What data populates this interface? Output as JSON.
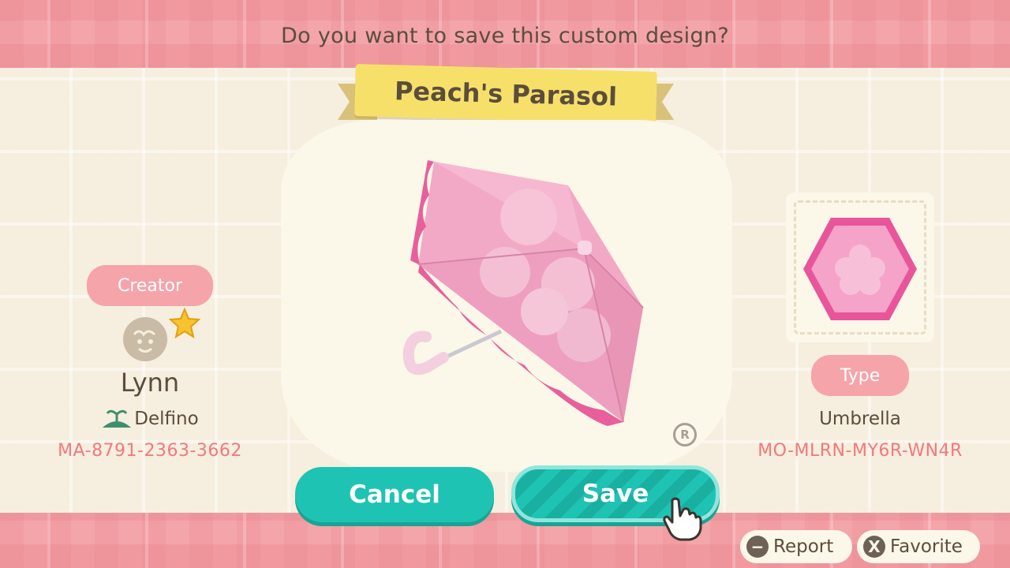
{
  "dialog": {
    "prompt": "Do you want to save this custom design?",
    "design_title": "Peach's Parasol"
  },
  "creator": {
    "section_label": "Creator",
    "name": "Lynn",
    "island": "Delfino",
    "creator_code": "MA-8791-2363-3662"
  },
  "design": {
    "type_label": "Type",
    "type": "Umbrella",
    "design_code": "MO-MLRN-MY6R-WN4R",
    "badge": "R"
  },
  "buttons": {
    "cancel_label": "Cancel",
    "save_label": "Save"
  },
  "footer": {
    "report_glyph": "−",
    "report_label": "Report",
    "favorite_glyph": "X",
    "favorite_label": "Favorite"
  },
  "colors": {
    "accent_teal": "#1ec3b3",
    "pink_band": "#f3a5aa",
    "banner_yellow": "#f7e06a",
    "code_pink": "#f07a7e",
    "text_brown": "#5b4d3c"
  },
  "icons": [
    "villager-avatar-icon",
    "star-icon",
    "island-icon",
    "hand-cursor-icon",
    "minus-button-icon",
    "x-button-icon",
    "pro-design-badge-icon"
  ]
}
